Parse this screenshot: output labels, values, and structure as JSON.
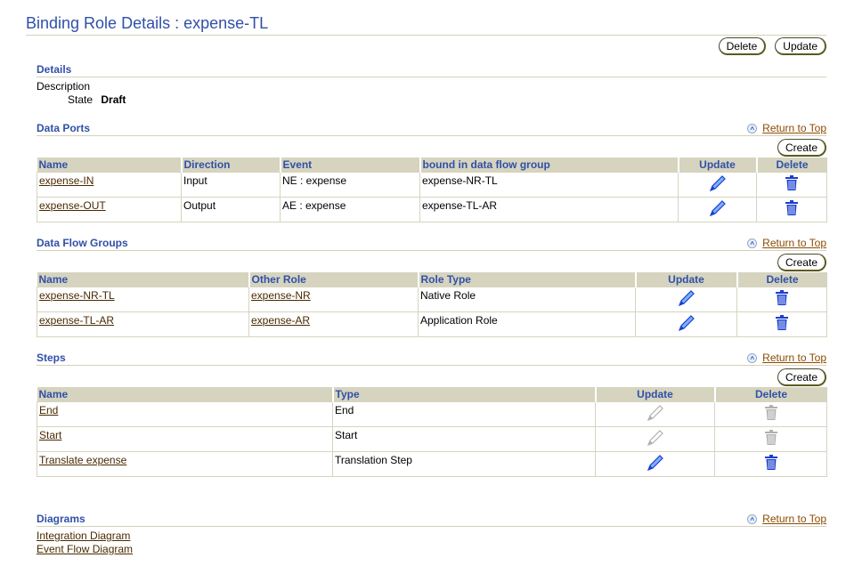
{
  "page": {
    "title": "Binding Role Details : expense-TL",
    "delete_label": "Delete",
    "update_label": "Update"
  },
  "details": {
    "title": "Details",
    "description_label": "Description",
    "description_value": "",
    "state_label": "State",
    "state_value": "Draft"
  },
  "return_to_top": "Return to Top",
  "create_label": "Create",
  "data_ports": {
    "title": "Data Ports",
    "columns": [
      "Name",
      "Direction",
      "Event",
      "bound in data flow group",
      "Update",
      "Delete"
    ],
    "rows": [
      {
        "name": "expense-IN",
        "direction": "Input",
        "event": "NE : expense",
        "group": "expense-NR-TL",
        "update_enabled": true,
        "delete_enabled": true
      },
      {
        "name": "expense-OUT",
        "direction": "Output",
        "event": "AE : expense",
        "group": "expense-TL-AR",
        "update_enabled": true,
        "delete_enabled": true
      }
    ]
  },
  "data_flow_groups": {
    "title": "Data Flow Groups",
    "columns": [
      "Name",
      "Other Role",
      "Role Type",
      "Update",
      "Delete"
    ],
    "rows": [
      {
        "name": "expense-NR-TL",
        "other_role": "expense-NR",
        "role_type": "Native Role",
        "update_enabled": true,
        "delete_enabled": true
      },
      {
        "name": "expense-TL-AR",
        "other_role": "expense-AR",
        "role_type": "Application Role",
        "update_enabled": true,
        "delete_enabled": true
      }
    ]
  },
  "steps": {
    "title": "Steps",
    "columns": [
      "Name",
      "Type",
      "Update",
      "Delete"
    ],
    "rows": [
      {
        "name": "End",
        "type": "End",
        "update_enabled": false,
        "delete_enabled": false
      },
      {
        "name": "Start",
        "type": "Start",
        "update_enabled": false,
        "delete_enabled": false
      },
      {
        "name": "Translate expense",
        "type": "Translation Step",
        "update_enabled": true,
        "delete_enabled": true
      }
    ]
  },
  "diagrams": {
    "title": "Diagrams",
    "links": [
      "Integration Diagram",
      "Event Flow Diagram"
    ]
  },
  "colors": {
    "heading": "#3050a8",
    "link": "#4a2a00",
    "return_link": "#8a4b00",
    "table_header_bg": "#d6d4bf",
    "icon_active": "#1a3fcf",
    "icon_disabled": "#b0b0b0"
  }
}
